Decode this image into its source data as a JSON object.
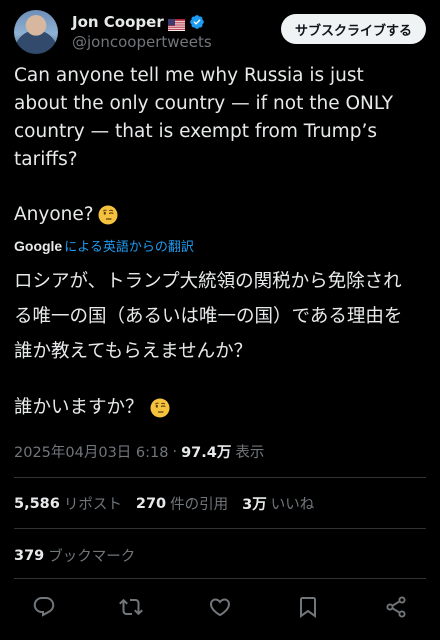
{
  "author": {
    "display_name": "Jon Cooper",
    "flag": "🇺🇸",
    "handle": "@joncoopertweets"
  },
  "subscribe_label": "サブスクライブする",
  "tweet": {
    "lines": [
      "Can anyone tell me why Russia is just",
      "about the only country — if not the ONLY",
      "country — that is exempt from Trump’s",
      "tariffs?"
    ],
    "anyone": "Anyone?"
  },
  "translation": {
    "provider": "Google",
    "label": "による英語からの翻訳",
    "lines": [
      "ロシアが、トランプ大統領の関税から免除され",
      "る唯一の国（あるいは唯一の国）である理由を",
      "誰か教えてもらえませんか？"
    ],
    "question": "誰かいますか？"
  },
  "meta": {
    "datetime": "2025年04月03日 6:18",
    "dot": "·",
    "views_count": "97.4万",
    "views_label": "表示"
  },
  "stats": {
    "reposts_count": "5,586",
    "reposts_label": "リポスト",
    "quotes_count": "270",
    "quotes_label": "件の引用",
    "likes_count": "3万",
    "likes_label": "いいね",
    "bookmarks_count": "379",
    "bookmarks_label": "ブックマーク"
  },
  "icons": [
    "verified-icon",
    "emoji-face-icon",
    "reply-icon",
    "retweet-icon",
    "like-icon",
    "bookmark-icon",
    "share-icon"
  ],
  "colors": {
    "background": "#000000",
    "text": "#e7e9ea",
    "muted": "#71767b",
    "link": "#1d9bf0",
    "verified": "#1d9bf0"
  }
}
